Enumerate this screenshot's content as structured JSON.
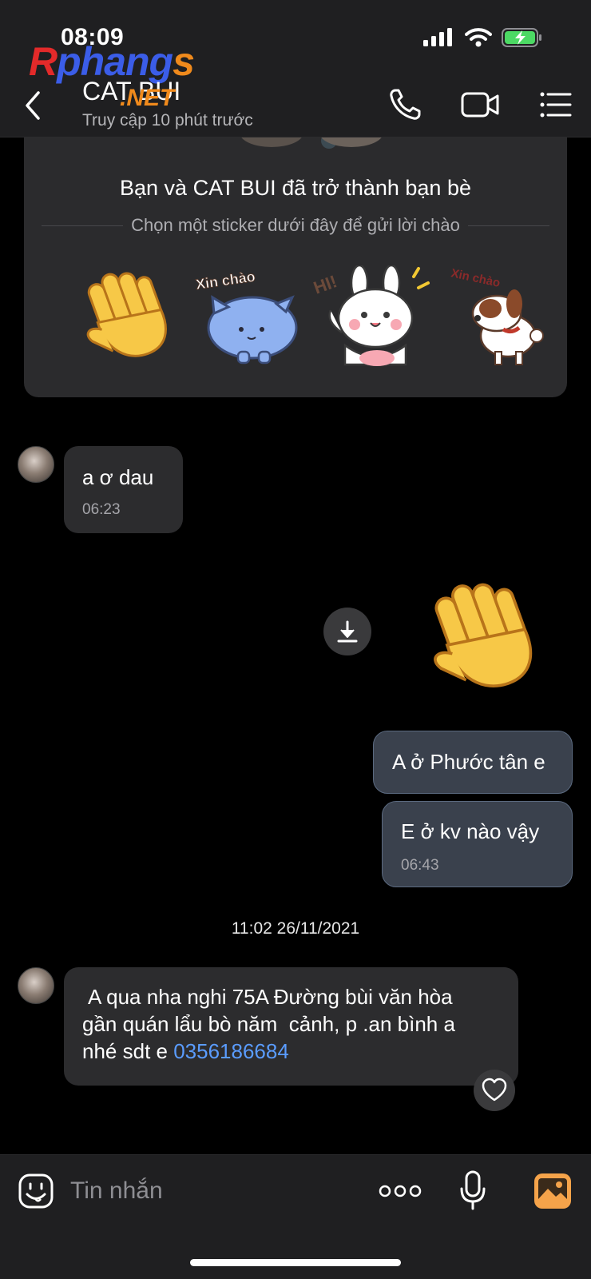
{
  "status_bar": {
    "time": "08:09"
  },
  "watermark": {
    "brand_r": "R",
    "brand_phang": "phang",
    "brand_s": "s",
    "brand_net": ".NET"
  },
  "header": {
    "contact_name": "CAT BUI",
    "contact_status": "Truy cập 10 phút trước"
  },
  "sticker_card": {
    "title": "Bạn và CAT BUI đã trở thành bạn bè",
    "subtitle": "Chọn một sticker dưới đây để gửi lời chào",
    "stickers": [
      {
        "icon": "waving-hand-icon"
      },
      {
        "icon": "xin-chao-cat-sticker",
        "caption": "Xin chào"
      },
      {
        "icon": "hi-bunny-sticker",
        "caption": "HI!"
      },
      {
        "icon": "xin-chao-dog-sticker",
        "caption": "Xin chào"
      }
    ]
  },
  "messages": [
    {
      "direction": "incoming",
      "text": "a ơ dau",
      "time": "06:23"
    },
    {
      "direction": "outgoing",
      "type": "sticker",
      "icon": "waving-hand-icon"
    },
    {
      "direction": "outgoing",
      "text": "A ở Phước tân e"
    },
    {
      "direction": "outgoing",
      "text": "E ở kv nào vậy",
      "time": "06:43"
    }
  ],
  "date_separator": "11:02 26/11/2021",
  "last_message": {
    "direction": "incoming",
    "line1": "A qua nha nghi 75A Đường bùi văn hòa",
    "line2": "gần quán lẩu bò năm  cảnh, p .an bình a",
    "line3_prefix": "nhé sdt e ",
    "phone": "0356186684"
  },
  "input_bar": {
    "placeholder": "Tin nhắn"
  },
  "colors": {
    "header_bg": "#1f1f21",
    "incoming_bubble": "#2c2c2e",
    "outgoing_bubble": "#3a414d",
    "link": "#5a9cff",
    "photo_icon": "#f5a34a"
  }
}
